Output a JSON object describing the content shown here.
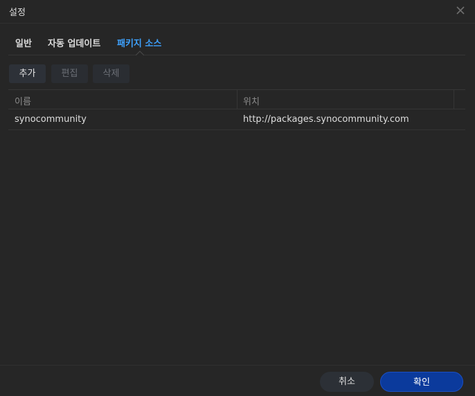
{
  "dialog": {
    "title": "설정"
  },
  "tabs": [
    {
      "label": "일반"
    },
    {
      "label": "자동 업데이트"
    },
    {
      "label": "패키지 소스",
      "active": true
    }
  ],
  "toolbar": {
    "add_label": "추가",
    "edit_label": "편집",
    "delete_label": "삭제"
  },
  "grid": {
    "columns": [
      "이름",
      "위치"
    ],
    "rows": [
      {
        "name": "synocommunity",
        "location": "http://packages.synocommunity.com"
      }
    ]
  },
  "footer": {
    "cancel_label": "취소",
    "ok_label": "확인"
  },
  "colors": {
    "active_tab": "#3ea2ff",
    "primary_button": "#0b3a9c",
    "background": "#262626"
  },
  "icons": {
    "close": "close-icon"
  }
}
